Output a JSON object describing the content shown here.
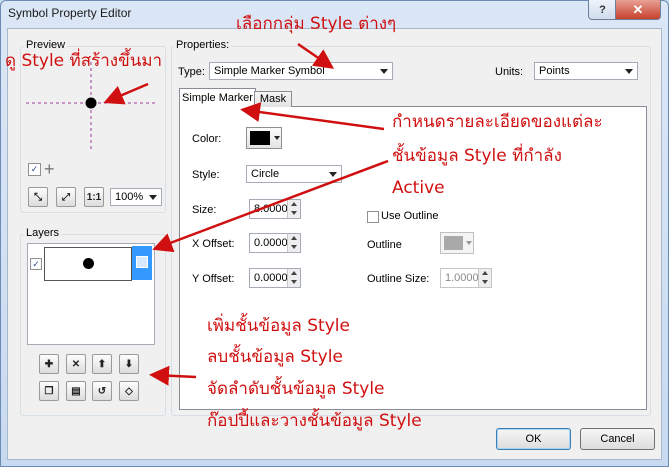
{
  "window": {
    "title": "Symbol Property Editor",
    "help_label": "?",
    "close_label": "✕"
  },
  "preview": {
    "label": "Preview",
    "zoom_value": "100%"
  },
  "layers": {
    "label": "Layers"
  },
  "properties": {
    "label": "Properties:",
    "type_label": "Type:",
    "type_value": "Simple Marker Symbol",
    "units_label": "Units:",
    "units_value": "Points"
  },
  "tabs": {
    "simple_marker": "Simple Marker",
    "mask": "Mask"
  },
  "fields": {
    "color_label": "Color:",
    "style_label": "Style:",
    "style_value": "Circle",
    "size_label": "Size:",
    "size_value": "8.0000",
    "xoffset_label": "X Offset:",
    "xoffset_value": "0.0000",
    "yoffset_label": "Y Offset:",
    "yoffset_value": "0.0000",
    "use_outline_label": "Use Outline",
    "outline_label": "Outline",
    "outline_size_label": "Outline Size:",
    "outline_size_value": "1.0000"
  },
  "buttons": {
    "ok": "OK",
    "cancel": "Cancel"
  },
  "annotations": {
    "choose_style_group": "เลือกกลุ่ม Style ต่างๆ",
    "view_style": "ดู Style ที่สร้างขึ้นมา",
    "detail_line1": "กำหนดรายละเอียดของแต่ละ",
    "detail_line2": "ชั้นข้อมูล Style ที่กำลัง",
    "detail_line3": "Active",
    "add_layer": "เพิ่มชั้นข้อมูล Style",
    "remove_layer": "ลบชั้นข้อมูล Style",
    "order_layer": "จัดลำดับชั้นข้อมูล Style",
    "copy_paste_layer": "ก๊อปปี้และวางชั้นข้อมูล Style"
  },
  "colors": {
    "annotation": "#d01010",
    "marker_color": "#000000",
    "preview_guides": "#9b3d9b",
    "selected_layer": "#3399ff"
  }
}
